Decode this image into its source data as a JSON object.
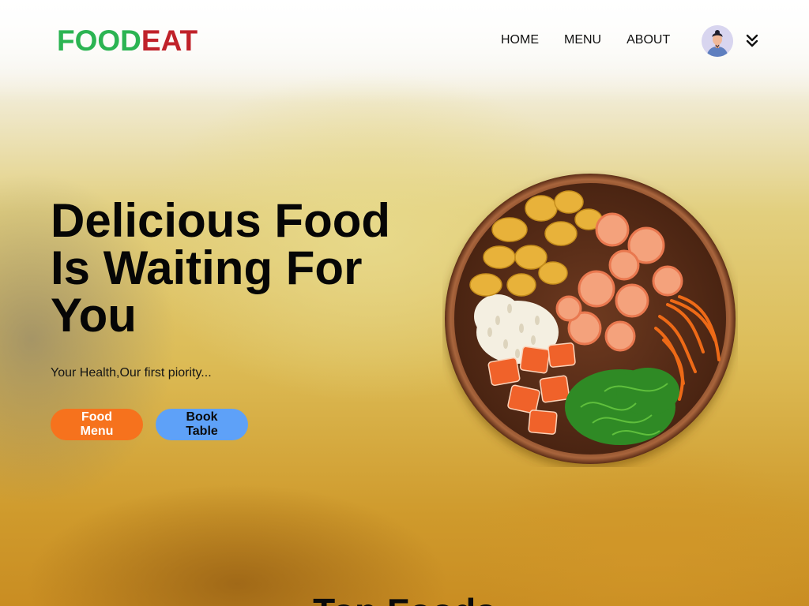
{
  "brand": {
    "part1": "FOOD",
    "part2": "EAT"
  },
  "nav": {
    "items": [
      "HOME",
      "MENU",
      "ABOUT"
    ]
  },
  "user": {
    "avatar_icon": "user-avatar-icon",
    "menu_icon": "double-chevron-down-icon"
  },
  "hero": {
    "title_lines": [
      "Delicious Food",
      "Is Waiting For",
      "You"
    ],
    "subtitle": "Your Health,Our first piority...",
    "primary_button": "Food Menu",
    "secondary_button": "Book Table",
    "image": "food-bowl-image"
  },
  "next_section": {
    "title": "Top Foods"
  },
  "colors": {
    "brand_green": "#2bb452",
    "brand_red": "#c0222a",
    "primary_button": "#f6721d",
    "secondary_button": "#5ea1f8"
  }
}
